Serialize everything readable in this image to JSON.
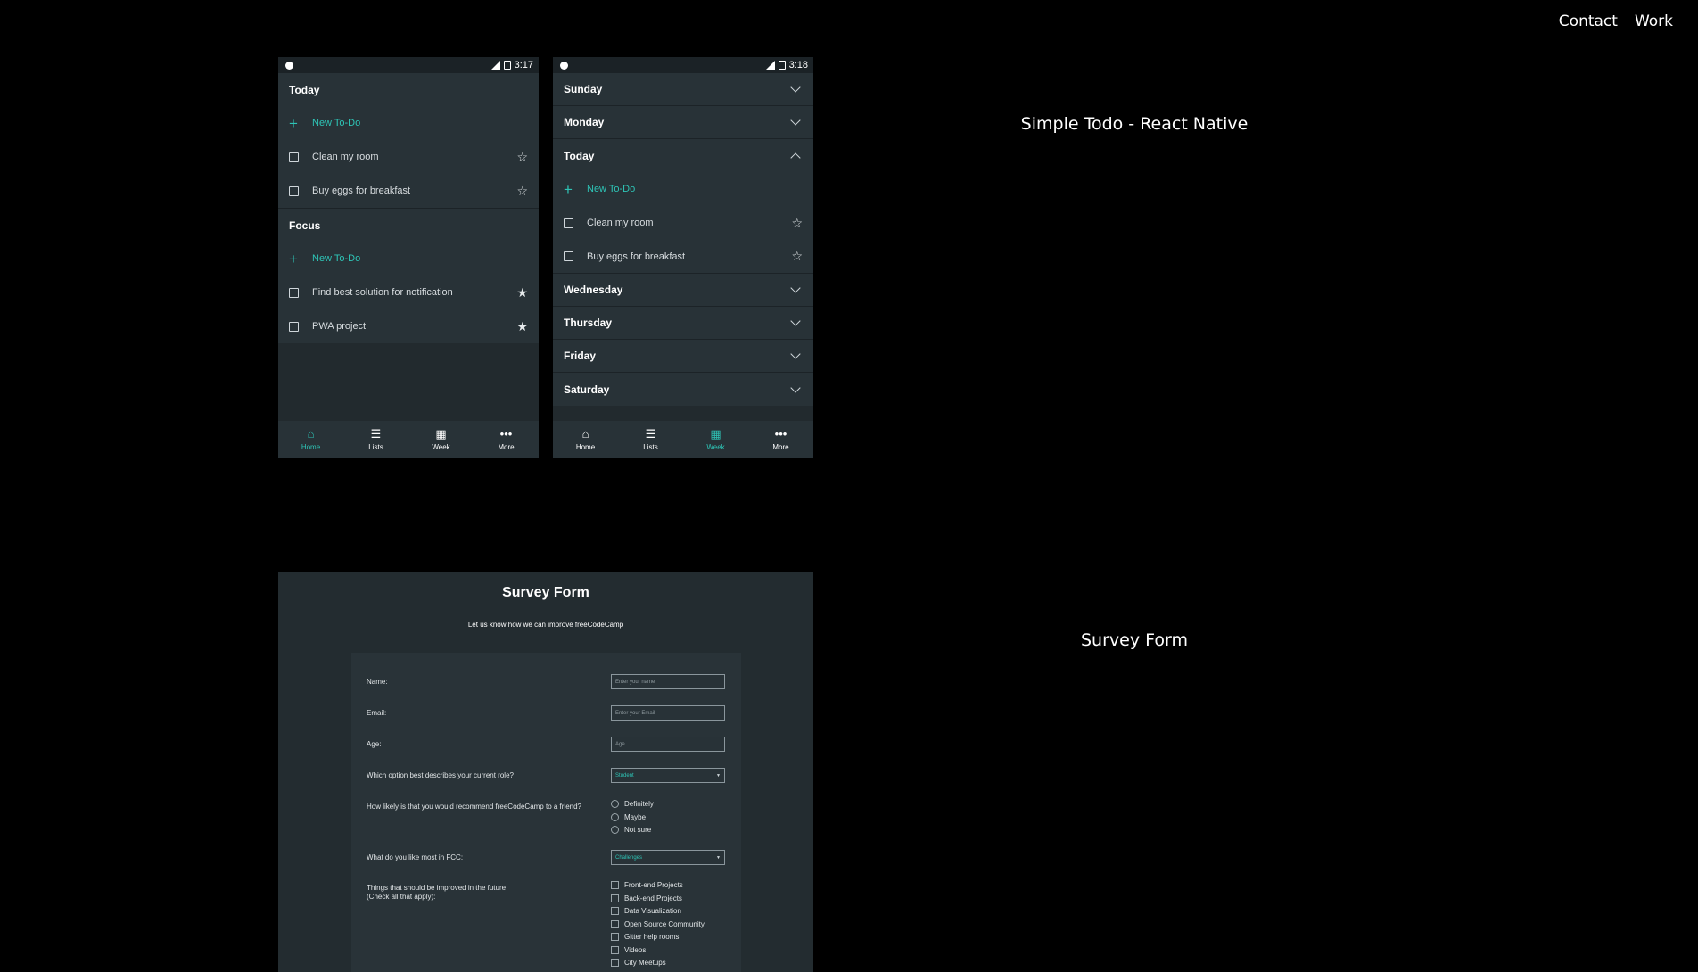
{
  "nav": {
    "contact": "Contact",
    "work": "Work"
  },
  "projects": {
    "todo_title": "Simple Todo - React Native",
    "survey_title": "Survey Form"
  },
  "phone1": {
    "time": "3:17",
    "today": {
      "heading": "Today",
      "new_todo": "New To-Do",
      "items": [
        {
          "label": "Clean my room",
          "starred": false
        },
        {
          "label": "Buy eggs for breakfast",
          "starred": false
        }
      ]
    },
    "focus": {
      "heading": "Focus",
      "new_todo": "New To-Do",
      "items": [
        {
          "label": "Find best solution for notification",
          "starred": true
        },
        {
          "label": "PWA project",
          "starred": true
        }
      ]
    }
  },
  "phone2": {
    "time": "3:18",
    "days_before": [
      "Sunday",
      "Monday"
    ],
    "today": {
      "heading": "Today",
      "new_todo": "New To-Do",
      "items": [
        {
          "label": "Clean my room",
          "starred": false
        },
        {
          "label": "Buy eggs for breakfast",
          "starred": false
        }
      ]
    },
    "days_after": [
      "Wednesday",
      "Thursday",
      "Friday",
      "Saturday"
    ]
  },
  "tabs": [
    "Home",
    "Lists",
    "Week",
    "More"
  ],
  "survey": {
    "title": "Survey Form",
    "subtitle": "Let us know how we can improve freeCodeCamp",
    "name_label": "Name:",
    "name_placeholder": "Enter your name",
    "email_label": "Email:",
    "email_placeholder": "Enter your Email",
    "age_label": "Age:",
    "age_placeholder": "Age",
    "role_label": "Which option best describes your current role?",
    "role_value": "Student",
    "recommend_label": "How likely is that you would recommend freeCodeCamp to a friend?",
    "recommend_options": [
      "Definitely",
      "Maybe",
      "Not sure"
    ],
    "like_label": "What do you like most in FCC:",
    "like_value": "Challenges",
    "improve_label_1": "Things that should be improved in the future",
    "improve_label_2": "(Check all that apply):",
    "improve_options": [
      "Front-end Projects",
      "Back-end Projects",
      "Data Visualization",
      "Open Source Community",
      "Gitter help rooms",
      "Videos",
      "City Meetups"
    ]
  },
  "colors": {
    "accent": "#2ec4b6",
    "panel": "#283237",
    "background": "#000000"
  }
}
